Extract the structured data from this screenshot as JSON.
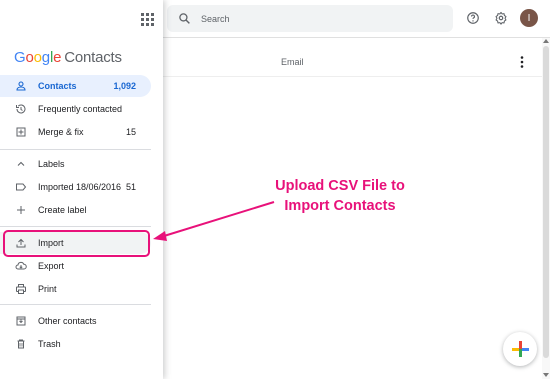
{
  "colors": {
    "accent": "#1967d2",
    "annotation": "#e8117a",
    "avatar": "#795548"
  },
  "logo": {
    "google_letters": [
      "G",
      "o",
      "o",
      "g",
      "l",
      "e"
    ],
    "product": "Contacts"
  },
  "search": {
    "placeholder": "Search"
  },
  "header": {
    "avatar_initial": "I",
    "icons": [
      "help-icon",
      "settings-icon"
    ]
  },
  "sidebar": {
    "items": [
      {
        "label": "Contacts",
        "count": "1,092",
        "icon": "person-icon"
      },
      {
        "label": "Frequently contacted",
        "count": "",
        "icon": "history-icon"
      },
      {
        "label": "Merge & fix",
        "count": "15",
        "icon": "merge-icon"
      }
    ],
    "labels_heading": "Labels",
    "labels": [
      {
        "label": "Imported 18/06/2016",
        "count": "51",
        "icon": "label-icon"
      },
      {
        "label": "Create label",
        "count": "",
        "icon": "plus-icon"
      }
    ],
    "actions": [
      {
        "label": "Import",
        "icon": "upload-icon"
      },
      {
        "label": "Export",
        "icon": "cloud-download-icon"
      },
      {
        "label": "Print",
        "icon": "print-icon"
      }
    ],
    "others": [
      {
        "label": "Other contacts",
        "icon": "archive-icon"
      },
      {
        "label": "Trash",
        "icon": "trash-icon"
      }
    ]
  },
  "table": {
    "column_email": "Email"
  },
  "annotation": {
    "line1": "Upload CSV File to",
    "line2": "Import Contacts"
  }
}
